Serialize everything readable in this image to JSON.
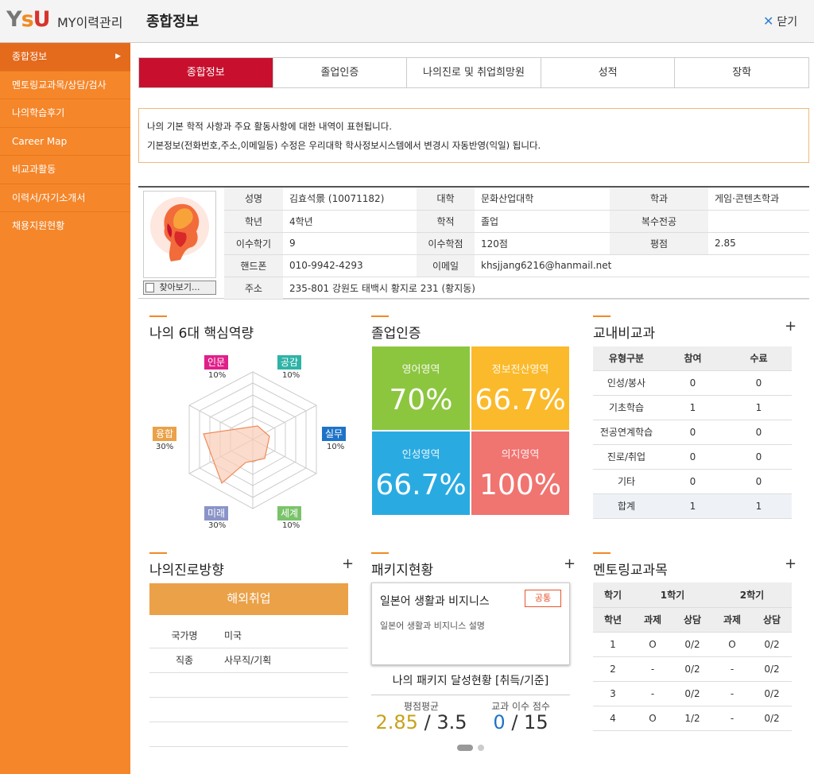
{
  "header": {
    "app_title": "MY이력관리",
    "page_title": "종합정보",
    "close_label": "닫기",
    "logo_y": "Y",
    "logo_s": "s",
    "logo_u": "U"
  },
  "sidebar": {
    "items": [
      {
        "label": "종합정보"
      },
      {
        "label": "멘토링교과목/상담/검사"
      },
      {
        "label": "나의학습후기"
      },
      {
        "label": "Career Map"
      },
      {
        "label": "비교과활동"
      },
      {
        "label": "이력서/자기소개서"
      },
      {
        "label": "채용지원현황"
      }
    ]
  },
  "tabs": [
    {
      "label": "종합정보"
    },
    {
      "label": "졸업인증"
    },
    {
      "label": "나의진로 및 취업희망원"
    },
    {
      "label": "성적"
    },
    {
      "label": "장학"
    }
  ],
  "notice": {
    "line1": "나의 기본 학적 사항과 주요 활동사항에 대한 내역이 표현됩니다.",
    "line2": "기본정보(전화번호,주소,이메일등) 수정은 우리대학 학사정보시스템에서 변경시 자동반영(익일) 됩니다."
  },
  "student": {
    "find_button": "찾아보기...",
    "name_label": "성명",
    "name": "김효석景 (10071182)",
    "college_label": "대학",
    "college": "문화산업대학",
    "dept_label": "학과",
    "dept": "게임·콘텐츠학과",
    "grade_label": "학년",
    "grade": "4학년",
    "status_label": "학적",
    "status": "졸업",
    "double_major_label": "복수전공",
    "double_major": "",
    "semesters_label": "이수학기",
    "semesters": "9",
    "credits_label": "이수학점",
    "credits": "120점",
    "gpa_label": "평점",
    "gpa": "2.85",
    "phone_label": "핸드폰",
    "phone": "010-9942-4293",
    "email_label": "이메일",
    "email": "khsjjang6216@hanmail.net",
    "address_label": "주소",
    "address": "235-801 강원도 태백시 황지로 231 (황지동)"
  },
  "competency": {
    "title": "나의 6대 핵심역량",
    "items": [
      {
        "name": "인문",
        "value": "10%",
        "color": "#e0208a"
      },
      {
        "name": "공감",
        "value": "10%",
        "color": "#2fb3a7"
      },
      {
        "name": "실무",
        "value": "10%",
        "color": "#1e73c8"
      },
      {
        "name": "세계",
        "value": "10%",
        "color": "#7ac36a"
      },
      {
        "name": "미래",
        "value": "30%",
        "color": "#8a94c8"
      },
      {
        "name": "융합",
        "value": "30%",
        "color": "#eba148"
      }
    ]
  },
  "graduation": {
    "title": "졸업인증",
    "cells": [
      {
        "name": "영어영역",
        "value": "70%",
        "color": "#8cc63f"
      },
      {
        "name": "정보전산영역",
        "value": "66.7%",
        "color": "#fbba2b"
      },
      {
        "name": "인성영역",
        "value": "66.7%",
        "color": "#29abe2"
      },
      {
        "name": "의지영역",
        "value": "100%",
        "color": "#f07470"
      }
    ]
  },
  "extracurricular": {
    "title": "교내비교과",
    "plus": "+",
    "headers": [
      "유형구분",
      "참여",
      "수료"
    ],
    "rows": [
      [
        "인성/봉사",
        "0",
        "0"
      ],
      [
        "기초학습",
        "1",
        "1"
      ],
      [
        "전공연계학습",
        "0",
        "0"
      ],
      [
        "진로/취업",
        "0",
        "0"
      ],
      [
        "기타",
        "0",
        "0"
      ]
    ],
    "total": [
      "합계",
      "1",
      "1"
    ]
  },
  "career": {
    "title": "나의진로방향",
    "plus": "+",
    "banner": "해외취업",
    "country_label": "국가명",
    "country": "미국",
    "job_label": "직종",
    "job": "사무직/기획"
  },
  "package": {
    "title": "패키지현황",
    "plus": "+",
    "name": "일본어 생활과 비지니스",
    "tag": "공통",
    "desc": "일본어 생활과 비지니스 설명",
    "achievement_title": "나의 패키지 달성현황 [취득/기준]",
    "gpa_avg_label": "평점평균",
    "gpa_avg": "2.85",
    "gpa_sep": "/",
    "gpa_std": "3.5",
    "course_label": "교과 이수 점수",
    "course_score": "0",
    "course_sep": "/",
    "course_std": "15"
  },
  "mentoring": {
    "title": "멘토링교과목",
    "plus": "+",
    "sem_header": "학기",
    "sem1": "1학기",
    "sem2": "2학기",
    "sub_headers": [
      "학년",
      "과제",
      "상담",
      "과제",
      "상담"
    ],
    "rows": [
      [
        "1",
        "O",
        "0/2",
        "O",
        "0/2"
      ],
      [
        "2",
        "-",
        "0/2",
        "-",
        "0/2"
      ],
      [
        "3",
        "-",
        "0/2",
        "-",
        "0/2"
      ],
      [
        "4",
        "O",
        "1/2",
        "-",
        "0/2"
      ]
    ]
  }
}
